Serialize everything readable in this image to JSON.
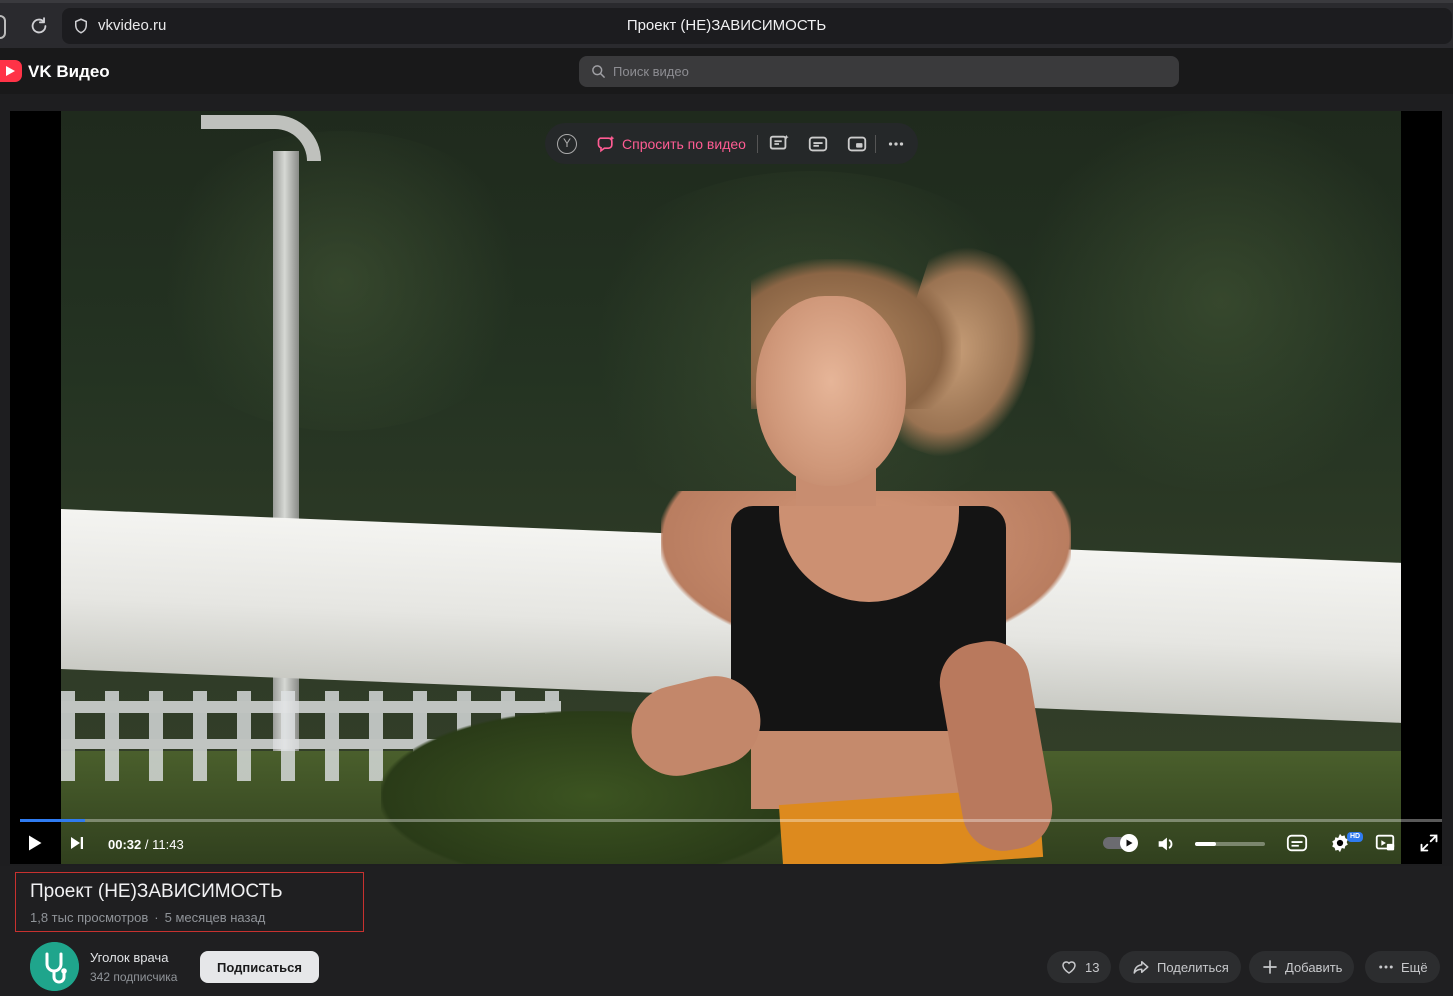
{
  "browser": {
    "url": "vkvideo.ru",
    "tab_title": "Проект (НЕ)ЗАВИСИМОСТЬ"
  },
  "header": {
    "brand": "VK Видео",
    "search_placeholder": "Поиск видео",
    "brand_color": "#ff3347"
  },
  "player": {
    "overlay": {
      "ask_label": "Спросить по видео"
    },
    "current_time": "00:32",
    "duration": "11:43",
    "progress_fraction": 0.046,
    "volume_fraction": 0.3,
    "quality_badge": "HD",
    "accent_color": "#2f7bf0"
  },
  "video": {
    "title": "Проект (НЕ)ЗАВИСИМОСТЬ",
    "views": "1,8 тыс просмотров",
    "dot": "·",
    "age": "5 месяцев назад"
  },
  "channel": {
    "name": "Уголок врача",
    "subscribers": "342 подписчика",
    "subscribe_label": "Подписаться"
  },
  "actions": {
    "likes": "13",
    "share_label": "Поделиться",
    "add_label": "Добавить",
    "more_label": "Ещё"
  }
}
